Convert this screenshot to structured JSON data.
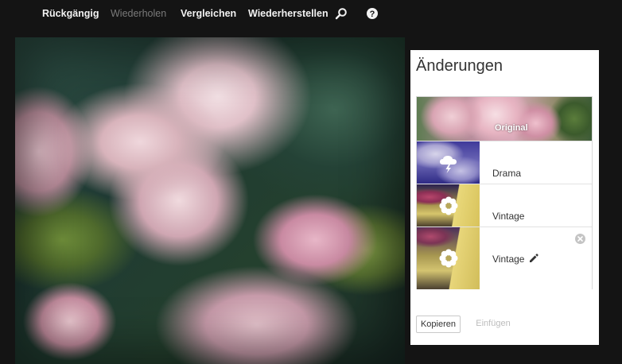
{
  "toolbar": {
    "undo_label": "Rückgängig",
    "redo_label": "Wiederholen",
    "compare_label": "Vergleichen",
    "restore_label": "Wiederherstellen",
    "search_icon": "search-icon",
    "help_icon": "help-icon",
    "redo_disabled": true
  },
  "panel": {
    "title": "Änderungen",
    "items": [
      {
        "label": "Original",
        "thumb": "original",
        "selected": true
      },
      {
        "label": "Drama",
        "thumb": "drama",
        "icon": "weather-storm-icon"
      },
      {
        "label": "Vintage",
        "thumb": "vintage",
        "icon": "flower-icon"
      },
      {
        "label": "Vintage",
        "thumb": "vintage",
        "icon": "flower-icon",
        "editable": true,
        "removable": true
      }
    ],
    "copy_label": "Kopieren",
    "paste_label": "Einfügen",
    "paste_disabled": true
  },
  "colors": {
    "background": "#141414",
    "toolbar_text": "#f2f2f2",
    "toolbar_disabled_text": "#7a7a7a",
    "panel_background": "#ffffff"
  }
}
